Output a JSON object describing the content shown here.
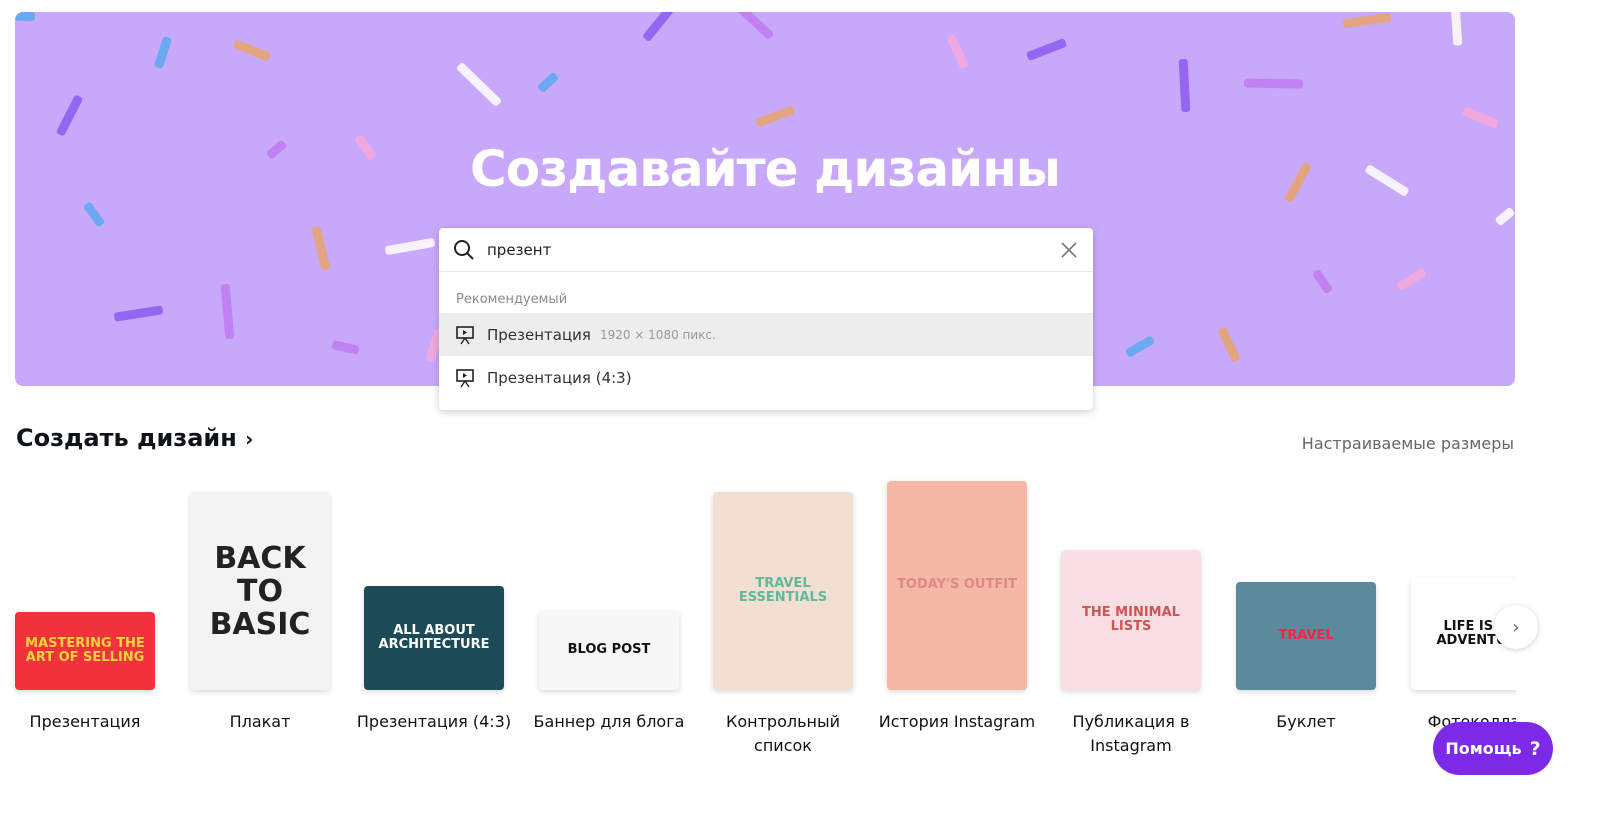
{
  "banner": {
    "title": "Создавайте дизайны",
    "color": "#c8a8fb"
  },
  "search": {
    "value": "презент",
    "section": "Рекомендуемый",
    "options": [
      {
        "label": "Презентация",
        "dims": "1920 × 1080 пикс.",
        "icon": "presentation-icon"
      },
      {
        "label": "Презентация (4:3)",
        "dims": "",
        "icon": "presentation-icon"
      }
    ]
  },
  "create": {
    "title": "Создать дизайн",
    "custom_sizes": "Настраиваемые размеры",
    "items": [
      {
        "label": "Презентация",
        "thumb_text": "MASTERING THE ART OF SELLING",
        "thumb_color": "#f0323c"
      },
      {
        "label": "Плакат",
        "thumb_text": "BACK TO BASIC",
        "thumb_color": "#f3f3f3"
      },
      {
        "label": "Презентация (4:3)",
        "thumb_text": "ALL ABOUT ARCHITECTURE",
        "thumb_color": "#1c4b57"
      },
      {
        "label": "Баннер для блога",
        "thumb_text": "BLOG POST",
        "thumb_color": "#f7f7f7"
      },
      {
        "label": "Контрольный список",
        "thumb_text": "TRAVEL ESSENTIALS",
        "thumb_color": "#f1dfd1"
      },
      {
        "label": "История Instagram",
        "thumb_text": "TODAY'S OUTFIT",
        "thumb_color": "#f6b8a6"
      },
      {
        "label": "Публикация в Instagram",
        "thumb_text": "THE MINIMAL LISTS",
        "thumb_color": "#f9dfe3"
      },
      {
        "label": "Буклет",
        "thumb_text": "TRAVEL",
        "thumb_color": "#5c8a9a"
      },
      {
        "label": "Фотоколлаж",
        "thumb_text": "LIFE IS AN ADVENTURE",
        "thumb_color": "#ffffff"
      }
    ]
  },
  "help": {
    "label": "Помощь",
    "icon": "?"
  }
}
